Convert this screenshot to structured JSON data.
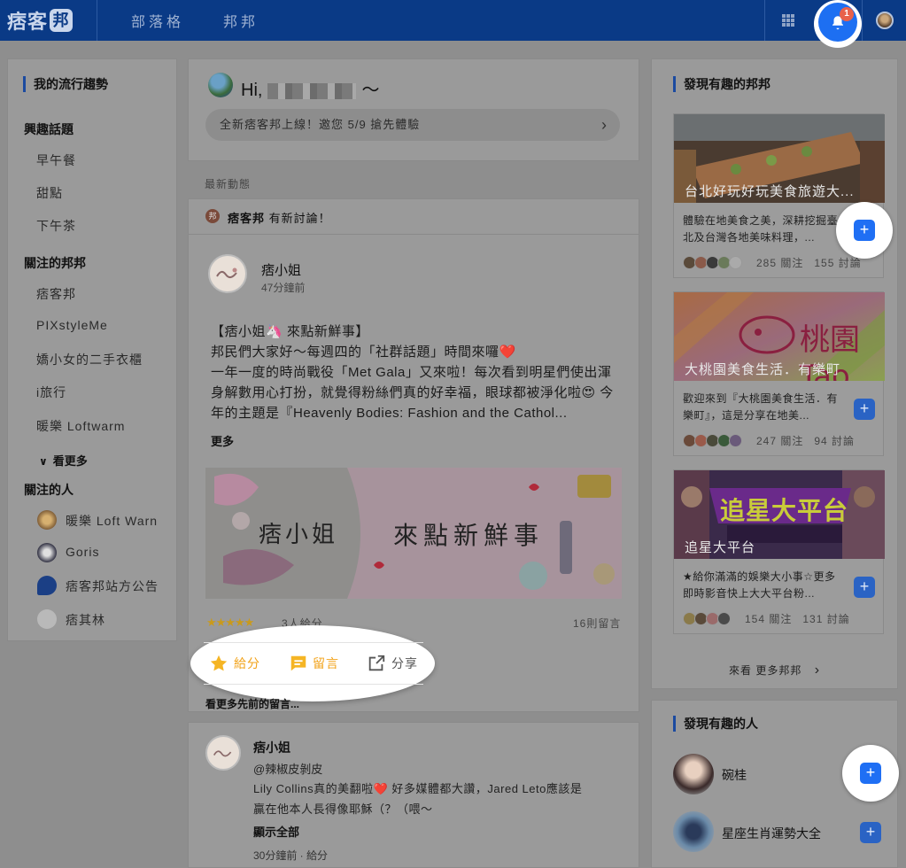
{
  "topbar": {
    "logo": "痞客",
    "logo_badge": "邦",
    "nav": [
      "部落格",
      "邦邦"
    ],
    "notification_count": "1",
    "colors": {
      "bar": "#0a3a86",
      "bell": "#1d6ff2",
      "badge": "#e8614b"
    }
  },
  "left": {
    "trend_title": "我的流行趨勢",
    "interest_title": "興趣話題",
    "interests": [
      "早午餐",
      "甜點",
      "下午茶"
    ],
    "follow_bang_title": "關注的邦邦",
    "follow_bangs": [
      "痞客邦",
      "PIXstyleMe",
      "嬌小女的二手衣櫃",
      "i旅行",
      "暖樂 Loftwarm"
    ],
    "see_more": "看更多",
    "follow_people_title": "關注的人",
    "people": [
      "暖樂 Loft Warn",
      "Goris",
      "痞客邦站方公告",
      "痞其林"
    ]
  },
  "greeting": {
    "hi": "Hi,",
    "tilde": "～",
    "promo": "全新痞客邦上線！邀您 5/9 搶先體驗",
    "promo_arrow": "›"
  },
  "feed": {
    "section_label": "最新動態",
    "header_logo": "邦",
    "header_source": "痞客邦",
    "header_text": "有新討論！",
    "post": {
      "author": "痞小姐",
      "time": "47分鐘前",
      "lines": [
        "【痞小姐🦄 來點新鮮事】",
        "邦民們大家好～每週四的「社群話題」時間來囉❤️",
        "一年一度的時尚戰役「Met Gala」又來啦！每次看到明星們使出渾",
        "身解數用心打扮，就覺得粉絲們真的好幸福，眼球都被淨化啦😍 今",
        "年的主題是『Heavenly Bodies: Fashion and the Cathol..."
      ],
      "more": "更多",
      "banner_left": "痞小姐",
      "banner_right": "來點新鮮事",
      "stars": "★★★★★",
      "rating_count": "3人給分",
      "comment_count": "16則留言",
      "actions": {
        "rate": "給分",
        "comment": "留言",
        "share": "分享"
      },
      "older_comments": "看更多先前的留言..."
    },
    "comment": {
      "author": "痞小姐",
      "mention": "@辣椒皮剝皮",
      "line1": "Lily Collins真的美翻啦❤️ 好多媒體都大讚，Jared Leto應該是",
      "line2": "贏在他本人長得像耶穌（？（喂～",
      "show_all": "顯示全部",
      "meta": "30分鐘前 · 給分"
    }
  },
  "right": {
    "discover_bang_title": "發現有趣的邦邦",
    "cards": [
      {
        "caption": "台北好玩好玩美食旅遊大...",
        "desc": "體驗在地美食之美，深耕挖掘臺北及台灣各地美味料理，...",
        "follows": "285 關注",
        "discussions": "155 討論"
      },
      {
        "caption": "大桃園美食生活．有樂町",
        "desc": "歡迎來到『大桃園美食生活．有樂町』，這是分享在地美...",
        "follows": "247 關注",
        "discussions": "94 討論",
        "logo_text": "桃園Tao"
      },
      {
        "caption": "追星大平台",
        "desc": "★給你滿滿的娛樂大小事☆更多即時影音快上大大平台粉...",
        "follows": "154 關注",
        "discussions": "131 討論",
        "logo_text": "追星大平台"
      }
    ],
    "see_more": "來看 更多邦邦",
    "see_more_arrow": "›",
    "discover_people_title": "發現有趣的人",
    "people": [
      "碗桂",
      "星座生肖運勢大全"
    ],
    "plus": "+"
  }
}
